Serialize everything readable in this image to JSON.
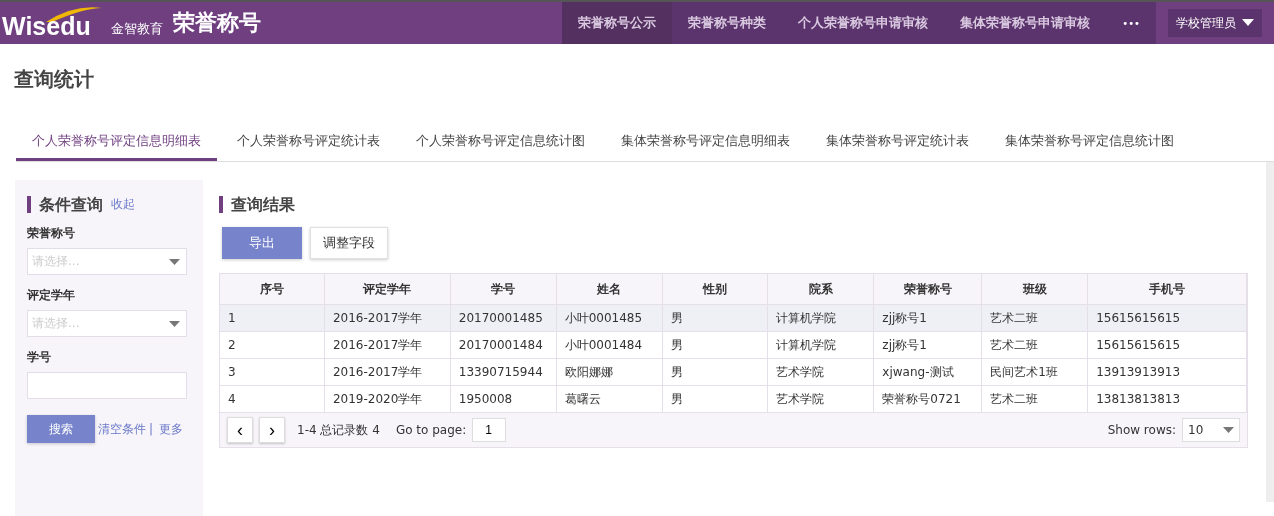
{
  "header": {
    "logo": "Wisedu",
    "logo_sub": "金智教育",
    "app_title": "荣誉称号",
    "nav": [
      {
        "label": "荣誉称号公示",
        "selected": true
      },
      {
        "label": "荣誉称号种类",
        "selected": false
      },
      {
        "label": "个人荣誉称号申请审核",
        "selected": false
      },
      {
        "label": "集体荣誉称号申请审核",
        "selected": false
      }
    ],
    "more": "•••",
    "role": "学校管理员"
  },
  "page_title": "查询统计",
  "tabs": [
    {
      "label": "个人荣誉称号评定信息明细表",
      "selected": true
    },
    {
      "label": "个人荣誉称号评定统计表",
      "selected": false
    },
    {
      "label": "个人荣誉称号评定信息统计图",
      "selected": false
    },
    {
      "label": "集体荣誉称号评定信息明细表",
      "selected": false
    },
    {
      "label": "集体荣誉称号评定统计表",
      "selected": false
    },
    {
      "label": "集体荣誉称号评定信息统计图",
      "selected": false
    }
  ],
  "filter": {
    "title": "条件查询",
    "collapse": "收起",
    "fields": [
      {
        "kind": "select",
        "label": "荣誉称号",
        "placeholder": "请选择..."
      },
      {
        "kind": "select",
        "label": "评定学年",
        "placeholder": "请选择..."
      },
      {
        "kind": "text",
        "label": "学号"
      }
    ],
    "search": "搜索",
    "clear": "清空条件",
    "separator": "|",
    "more": "更多"
  },
  "results": {
    "title": "查询结果",
    "export": "导出",
    "adjust": "调整字段",
    "columns": [
      "序号",
      "评定学年",
      "学号",
      "姓名",
      "性别",
      "院系",
      "荣誉称号",
      "班级",
      "手机号"
    ],
    "rows": [
      {
        "selected": true,
        "cells": [
          "1",
          "2016-2017学年",
          "20170001485",
          "小叶0001485",
          "男",
          "计算机学院",
          "zjj称号1",
          "艺术二班",
          "15615615615"
        ]
      },
      {
        "selected": false,
        "cells": [
          "2",
          "2016-2017学年",
          "20170001484",
          "小叶0001484",
          "男",
          "计算机学院",
          "zjj称号1",
          "艺术二班",
          "15615615615"
        ]
      },
      {
        "selected": false,
        "cells": [
          "3",
          "2016-2017学年",
          "13390715944",
          "欧阳娜娜",
          "男",
          "艺术学院",
          "xjwang-测试",
          "民间艺术1班",
          "13913913913"
        ]
      },
      {
        "selected": false,
        "cells": [
          "4",
          "2019-2020学年",
          "1950008",
          "葛曙云",
          "男",
          "艺术学院",
          "荣誉称号0721",
          "艺术二班",
          "13813813813"
        ]
      }
    ],
    "pager": {
      "prev": "‹",
      "next": "›",
      "summary": "1-4 总记录数 4",
      "goto_label": "Go to page:",
      "page": "1",
      "rows_label": "Show rows:",
      "rows": "10"
    }
  }
}
